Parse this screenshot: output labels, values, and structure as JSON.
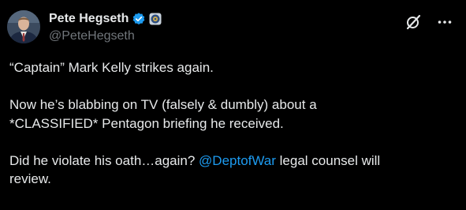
{
  "author": {
    "display_name": "Pete Hegseth",
    "handle": "@PeteHegseth",
    "verified_badge": "blue-check-icon",
    "affiliate_badge": "government-seal-icon"
  },
  "actions": {
    "grok_icon": "grok-icon",
    "more_icon": "more-options-icon"
  },
  "tweet": {
    "line1": "“Captain” Mark Kelly strikes again.",
    "line2": "Now he’s blabbing on TV (falsely & dumbly) about a",
    "line3": "*CLASSIFIED* Pentagon briefing he received.",
    "line4_prefix": "Did he violate his oath…again? ",
    "mention": "@DeptofWar",
    "line4_suffix": " legal counsel will",
    "line5": "review."
  },
  "colors": {
    "background": "#000000",
    "text": "#e7e9ea",
    "secondary": "#71767b",
    "link": "#1d9bf0",
    "verified": "#1d9bf0"
  }
}
